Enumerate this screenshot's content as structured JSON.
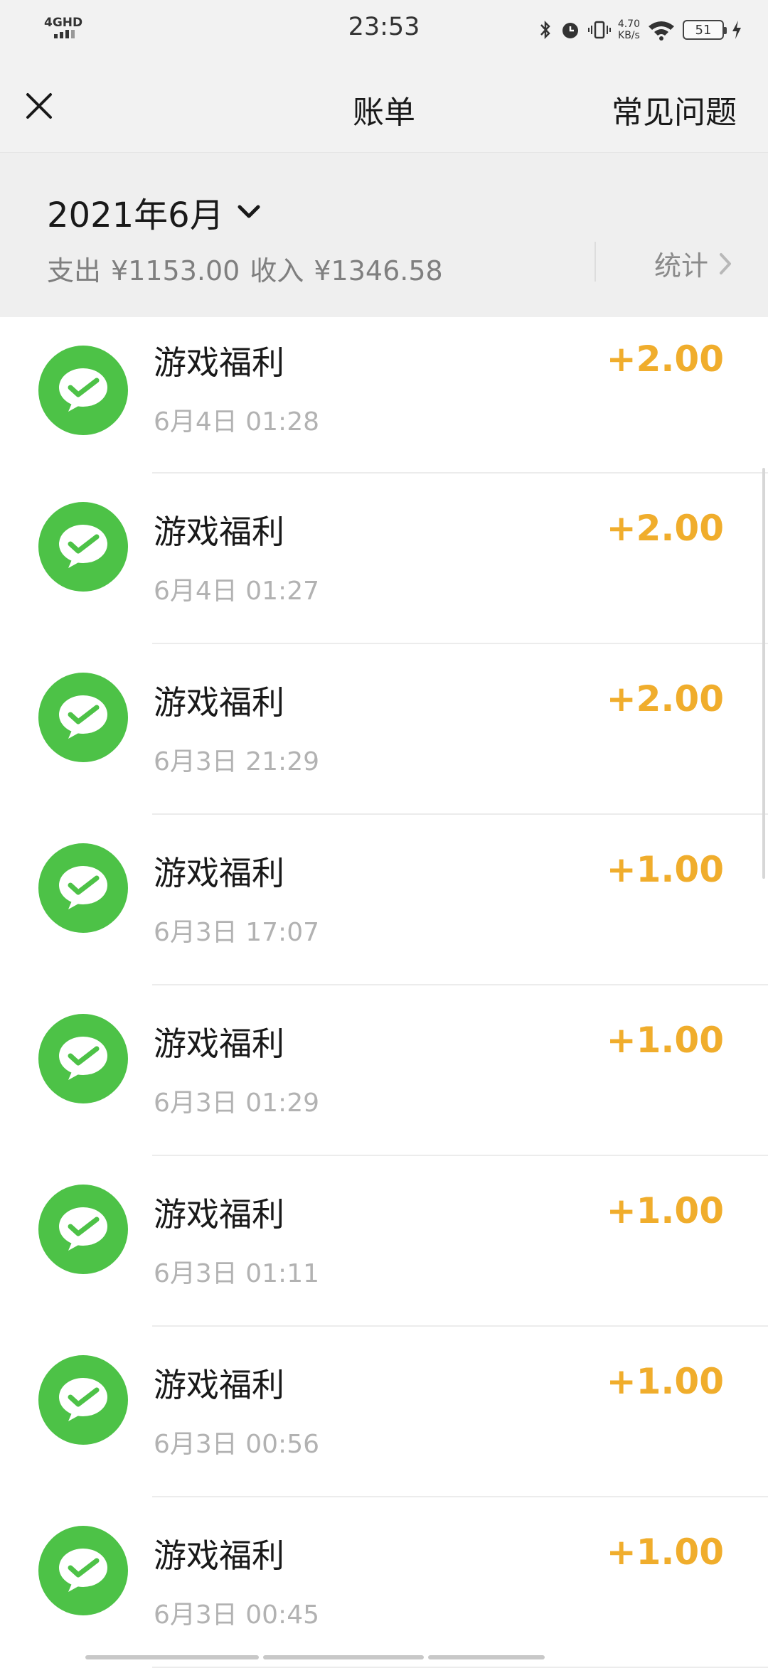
{
  "status_bar": {
    "network": "4GHD",
    "time": "23:53",
    "net_speed_value": "4.70",
    "net_speed_unit": "KB/s",
    "battery": "51"
  },
  "nav": {
    "title": "账单",
    "faq": "常见问题"
  },
  "summary": {
    "month": "2021年6月",
    "expense_label": "支出",
    "expense_value": "¥1153.00",
    "income_label": "收入",
    "income_value": "¥1346.58",
    "stats_label": "统计"
  },
  "colors": {
    "amount": "#f0ad2c",
    "avatar_bg": "#4dc247",
    "header_bg": "#f2f2f2"
  },
  "transactions": [
    {
      "title": "游戏福利",
      "time": "6月4日 01:28",
      "amount": "+2.00",
      "icon": "wechat-pay-icon"
    },
    {
      "title": "游戏福利",
      "time": "6月4日 01:27",
      "amount": "+2.00",
      "icon": "wechat-pay-icon"
    },
    {
      "title": "游戏福利",
      "time": "6月3日 21:29",
      "amount": "+2.00",
      "icon": "wechat-pay-icon"
    },
    {
      "title": "游戏福利",
      "time": "6月3日 17:07",
      "amount": "+1.00",
      "icon": "wechat-pay-icon"
    },
    {
      "title": "游戏福利",
      "time": "6月3日 01:29",
      "amount": "+1.00",
      "icon": "wechat-pay-icon"
    },
    {
      "title": "游戏福利",
      "time": "6月3日 01:11",
      "amount": "+1.00",
      "icon": "wechat-pay-icon"
    },
    {
      "title": "游戏福利",
      "time": "6月3日 00:56",
      "amount": "+1.00",
      "icon": "wechat-pay-icon"
    },
    {
      "title": "游戏福利",
      "time": "6月3日 00:45",
      "amount": "+1.00",
      "icon": "wechat-pay-icon"
    }
  ]
}
